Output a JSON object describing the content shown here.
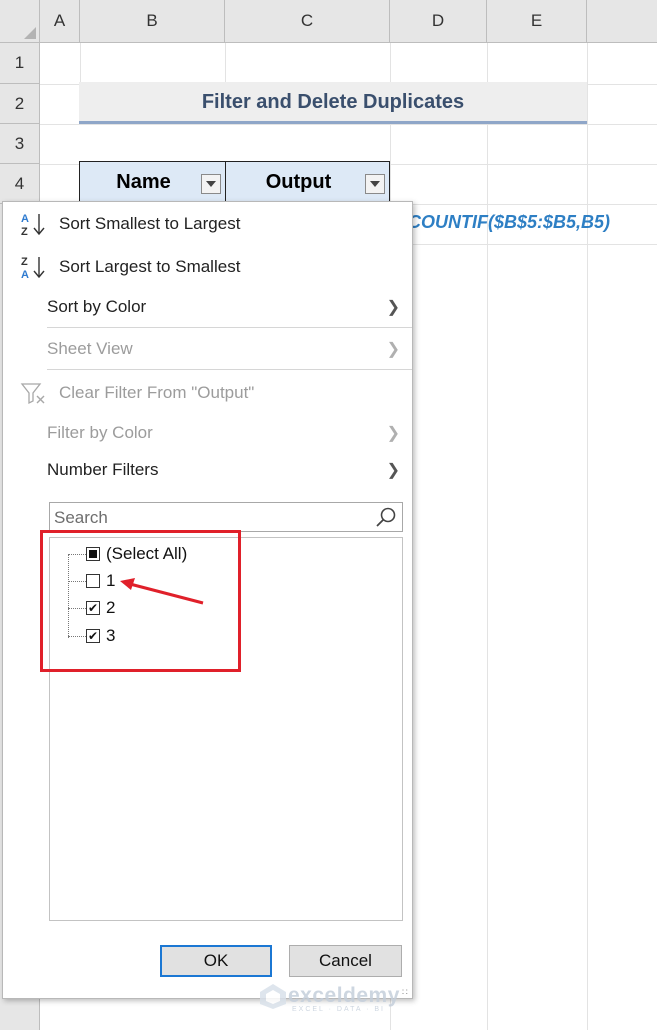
{
  "sheet": {
    "columns": [
      "A",
      "B",
      "C",
      "D",
      "E"
    ],
    "rows": [
      "1",
      "2",
      "3",
      "4"
    ],
    "title": "Filter and Delete Duplicates",
    "headers": {
      "name": "Name",
      "output": "Output"
    },
    "formula_fragment": "COUNTIF($B$5:$B5,B5)"
  },
  "menu": {
    "sort_asc": "Sort Smallest to Largest",
    "sort_desc": "Sort Largest to Smallest",
    "sort_by_color": "Sort by Color",
    "sheet_view": "Sheet View",
    "clear_filter": "Clear Filter From \"Output\"",
    "filter_by_color": "Filter by Color",
    "number_filters": "Number Filters",
    "search_placeholder": "Search",
    "items": [
      {
        "label": "(Select All)",
        "state": "partial"
      },
      {
        "label": "1",
        "state": "unchecked"
      },
      {
        "label": "2",
        "state": "checked"
      },
      {
        "label": "3",
        "state": "checked"
      }
    ],
    "ok": "OK",
    "cancel": "Cancel"
  },
  "icons": {
    "sort_asc": "sort-ascending-icon",
    "sort_desc": "sort-descending-icon",
    "submenu": "chevron-right-icon",
    "clear_filter": "clear-filter-icon",
    "search": "search-icon"
  },
  "colors": {
    "highlight": "#e0202a",
    "formula": "#2e7fc4",
    "header_fill": "#dde9f6",
    "title_text": "#3a4f6d"
  },
  "watermark": {
    "name": "exceldemy",
    "tagline": "EXCEL · DATA · BI"
  }
}
